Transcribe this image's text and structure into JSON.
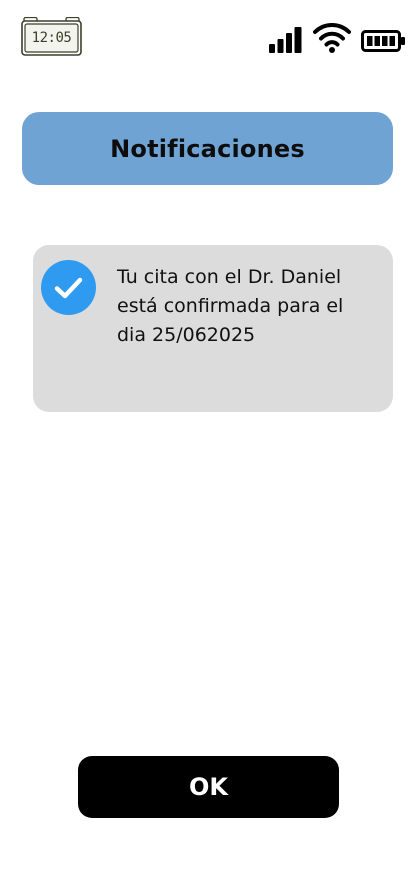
{
  "status_bar": {
    "time": "12:05",
    "icons": [
      "alarm-clock-icon",
      "signal-bars-icon",
      "wifi-icon",
      "battery-icon"
    ]
  },
  "header": {
    "title": "Notificaciones"
  },
  "notification": {
    "icon": "check-circle-icon",
    "line1": "Tu cita con el Dr. Daniel",
    "line2": "está confirmada para el",
    "line3": "dia 25/062025"
  },
  "actions": {
    "ok_label": "OK"
  },
  "colors": {
    "header_bg": "#6fa3d4",
    "card_bg": "#dcdcdc",
    "check_blue": "#2f9bf0",
    "button_bg": "#000000"
  }
}
